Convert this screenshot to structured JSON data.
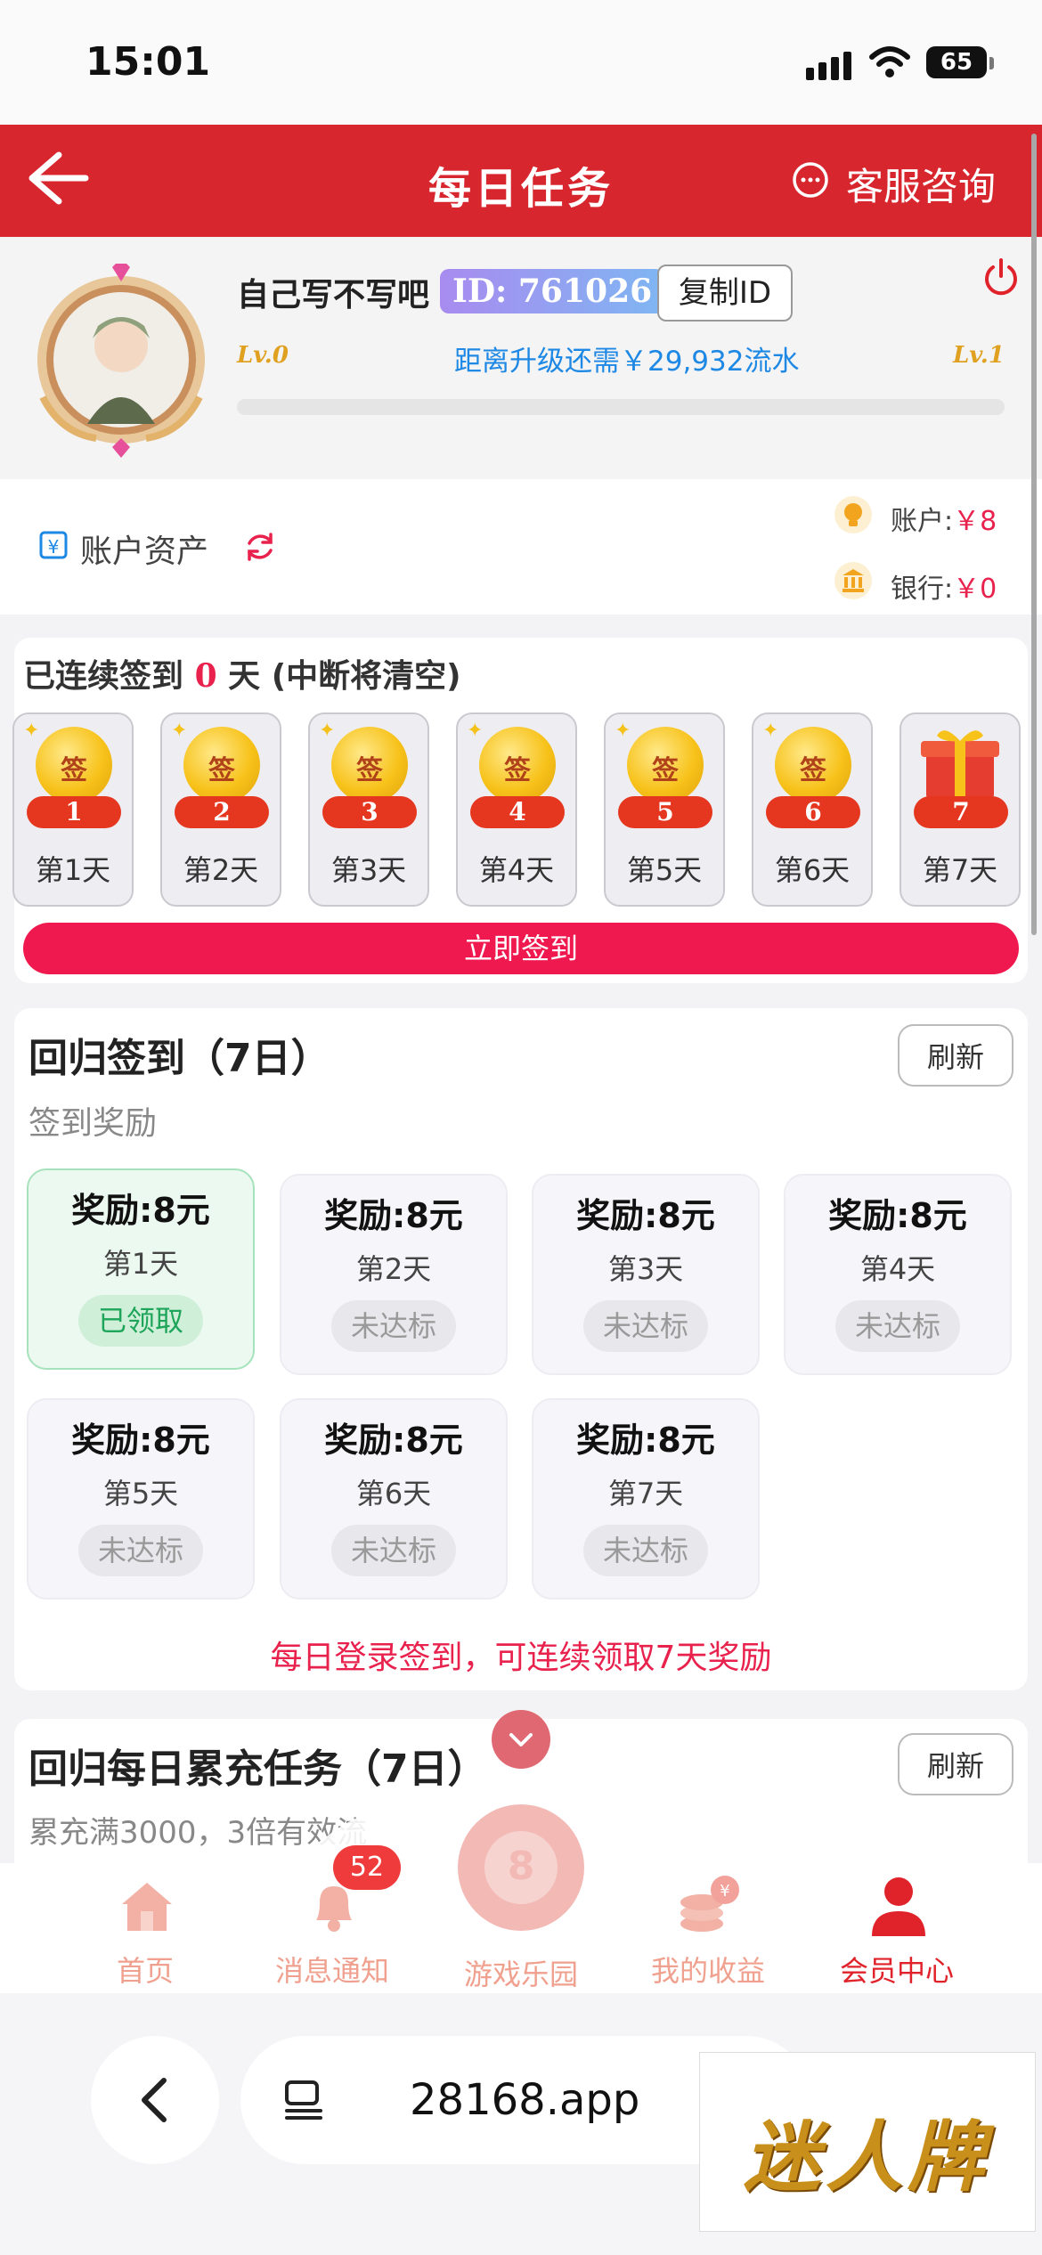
{
  "status_bar": {
    "time": "15:01",
    "battery": "65"
  },
  "header": {
    "title": "每日任务",
    "customer_service": "客服咨询"
  },
  "profile": {
    "username": "自己写不写吧",
    "id_badge": "ID: 761026",
    "copy_id": "复制ID",
    "level_current": "Lv.0",
    "level_next": "Lv.1",
    "upgrade_text": "距离升级还需￥29,932流水",
    "progress_percent": 0
  },
  "assets": {
    "label": "账户资产",
    "account_label": "账户:",
    "account_value": "￥8",
    "bank_label": "银行:",
    "bank_value": "￥0"
  },
  "signin": {
    "streak_prefix": "已连续签到",
    "streak_days": "0",
    "streak_suffix": "天 (中断将清空)",
    "coin_text": "签",
    "days": [
      {
        "num": "1",
        "label": "第1天"
      },
      {
        "num": "2",
        "label": "第2天"
      },
      {
        "num": "3",
        "label": "第3天"
      },
      {
        "num": "4",
        "label": "第4天"
      },
      {
        "num": "5",
        "label": "第5天"
      },
      {
        "num": "6",
        "label": "第6天"
      },
      {
        "num": "7",
        "label": "第7天"
      }
    ],
    "button": "立即签到"
  },
  "return_signin": {
    "title": "回归签到（7日）",
    "subtitle": "签到奖励",
    "refresh": "刷新",
    "rewards": [
      {
        "amount": "奖励:8元",
        "day": "第1天",
        "state": "已领取"
      },
      {
        "amount": "奖励:8元",
        "day": "第2天",
        "state": "未达标"
      },
      {
        "amount": "奖励:8元",
        "day": "第3天",
        "state": "未达标"
      },
      {
        "amount": "奖励:8元",
        "day": "第4天",
        "state": "未达标"
      },
      {
        "amount": "奖励:8元",
        "day": "第5天",
        "state": "未达标"
      },
      {
        "amount": "奖励:8元",
        "day": "第6天",
        "state": "未达标"
      },
      {
        "amount": "奖励:8元",
        "day": "第7天",
        "state": "未达标"
      }
    ],
    "note": "每日登录签到，可连续领取7天奖励"
  },
  "recharge_task": {
    "title": "回归每日累充任务（7日）",
    "subtitle": "累充满3000，3倍有效流",
    "refresh": "刷新"
  },
  "bottom_nav": {
    "items": [
      "首页",
      "消息通知",
      "游戏乐园",
      "我的收益",
      "会员中心"
    ],
    "badge": "52",
    "ball_number": "8"
  },
  "browser": {
    "url": "28168.app",
    "brand": "迷人牌"
  },
  "colors": {
    "primary_red": "#d8262f",
    "accent_pink": "#f0194f",
    "gold": "#e0a020",
    "link_blue": "#1e88e5"
  }
}
